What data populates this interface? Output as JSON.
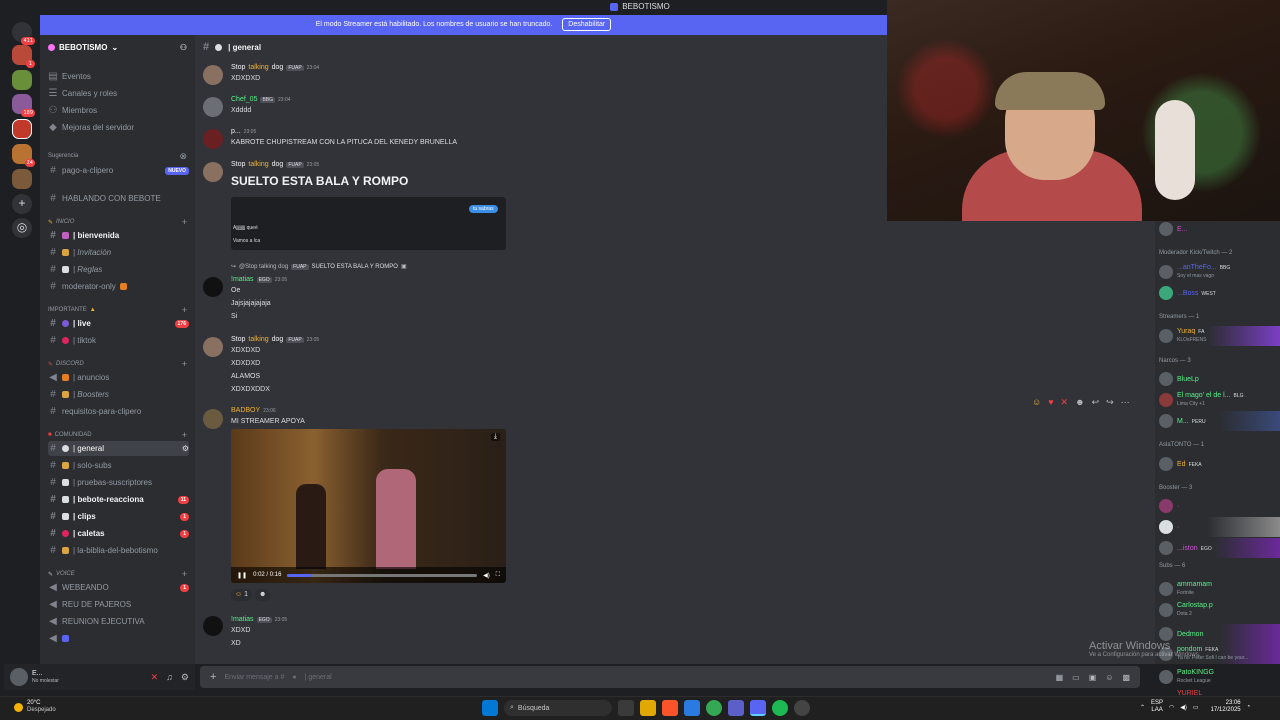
{
  "window": {
    "title": "BEBOTISMO"
  },
  "banner": {
    "text": "El modo Streamer está habilitado. Los nombres de usuario se han truncado.",
    "button": "Deshabilitar"
  },
  "rail": {
    "badges": [
      "411",
      "1",
      "189",
      "24"
    ]
  },
  "sidebar": {
    "server_name": "BEBOTISMO",
    "top_items": [
      "Eventos",
      "Canales y roles",
      "Miembros",
      "Mejoras del servidor"
    ],
    "suggestion_label": "Sugerencia",
    "suggestion_channel": "pago-a-clipero",
    "new_badge": "NUEVO",
    "hablando": "HABLANDO CON BEBOTE",
    "cat_inicio": "INICIO",
    "bienvenida": "| bienvenida",
    "invitacion": "| Invitación",
    "reglas": "| Reglas",
    "moderator": "moderator-only",
    "cat_importante": "IMPORTANTE",
    "live": "| live",
    "live_count": "176",
    "tiktok": "| tiktok",
    "cat_discord": "DISCORD",
    "anuncios": "| anuncios",
    "boosters": "| Boosters",
    "requisitos": "requisitos-para-clipero",
    "cat_comunidad": "COMUNIDAD",
    "general": "| general",
    "solo_subs": "| solo-subs",
    "pruebas": "| pruebas-suscriptores",
    "reaccion": "| bebote-reacciona",
    "reaccion_count": "11",
    "clips": "| clips",
    "clips_count": "1",
    "caletas": "| caletas",
    "caletas_count": "1",
    "biblia": "| la-biblia-del-bebotismo",
    "cat_voice": "VOICE",
    "webeando": "WEBEANDO",
    "webeando_count": "1",
    "reu_pajeros": "REU DE PAJEROS",
    "reunion": "REUNION EJECUTIVA"
  },
  "user_panel": {
    "name": "E...",
    "status": "No molestar"
  },
  "channel": {
    "name": "| general"
  },
  "messages": {
    "m1": {
      "user_a": "Stop ",
      "user_b": "talking",
      "user_c": " dog",
      "tag": "FUAP",
      "time": "23:04",
      "lines": [
        "XDXDXD"
      ]
    },
    "m2": {
      "user": "Chef_05",
      "tag": "BBG",
      "time": "23:04",
      "lines": [
        "Xdddd"
      ]
    },
    "m3": {
      "user": "p...",
      "time": "23:05",
      "lines": [
        "KABROTE CHUPISTREAM CON LA PITUCA DEL KENEDY BRUNELLA"
      ]
    },
    "m4": {
      "user_a": "Stop ",
      "user_b": "talking",
      "user_c": " dog",
      "tag": "FUAP",
      "time": "23:05",
      "big": "SUELTO ESTA BALA Y ROMPO",
      "embed_lines": [
        "Ajjjjjjjj queé",
        "Vamos a lca"
      ],
      "embed_pill": "tu sabras"
    },
    "m5": {
      "reply": "@Stop talking dog",
      "reply_tag": "FUAP",
      "reply_text": "SUELTO ESTA BALA Y ROMPO",
      "user": "!matias",
      "tag": "EGO",
      "time": "23:05",
      "lines": [
        "Oe",
        "Jajsjajajajaja",
        "Si"
      ]
    },
    "m6": {
      "user_a": "Stop ",
      "user_b": "talking",
      "user_c": " dog",
      "tag": "FUAP",
      "time": "23:05",
      "lines": [
        "XDXDXD",
        "XDXDXD",
        "ALAMOS",
        "XDXDXDDX"
      ]
    },
    "m7": {
      "user": "BADBOY",
      "time": "23:06",
      "lines": [
        "MI STREAMER APOYA"
      ],
      "video_time": "0:02 / 0:16",
      "video_progress": 0.13,
      "reaction_count": "1"
    },
    "m8": {
      "user": "!matias",
      "tag": "EGO",
      "time": "23:05",
      "lines": [
        "XDXD",
        "XD"
      ]
    }
  },
  "input": {
    "placeholder": "Enviar mensaje a #",
    "channel": "| general"
  },
  "members": {
    "top_partial": "E...",
    "mod_header": "Moderador Kick/Twitch — 2",
    "mod1": "...anTheFo...",
    "mod1_tag": "BBG",
    "mod1_sub": "Soy el mas vago",
    "mod2": "...Boss",
    "mod2_tag": "WEST",
    "streamers_header": "Streamers — 1",
    "str1": "Yuraq",
    "str1_tag": "FA",
    "str1_sub": "KLOsFRENS",
    "narcos_header": "Narcos — 3",
    "n1": "BlueLp",
    "n2": "El mago' el de l...",
    "n2_tag": "BLG",
    "n2_sub": "Lima City +1",
    "n3": "M...",
    "n3_tag": "PERU",
    "asla_header": "AslaTONTO — 1",
    "a1": "Ed",
    "a1_tag": "FEKA",
    "booster_header": "Booster — 3",
    "b3": "...iston",
    "b3_tag": "EGO",
    "subs_header": "Subs — 6",
    "s1": "ammamam",
    "s1_sub": "Fortnite",
    "s2": "Carlostap.p",
    "s2_sub": "Dota 2",
    "s3": "Dedmon",
    "s4": "pondom",
    "s4_tag": "FEKA",
    "s4_sub": "Ya no' Peter Sofi I can be your...",
    "s5": "PatoKINGG",
    "s5_sub": "Rocket League",
    "s6": "YURIEL"
  },
  "watermark": {
    "line1": "Activar Windows",
    "line2": "Ve a Configuración para activar Windows."
  },
  "taskbar": {
    "temp": "20°C",
    "weather": "Despejado",
    "search": "Búsqueda",
    "lang1": "ESP",
    "lang2": "LAA",
    "time": "23:06",
    "date": "17/12/2025"
  },
  "colors": {
    "accent": "#5865f2",
    "online_green": "#23a559",
    "mention_red": "#f23f43",
    "talking_orange": "#f0b232",
    "user_green": "#57f287"
  }
}
